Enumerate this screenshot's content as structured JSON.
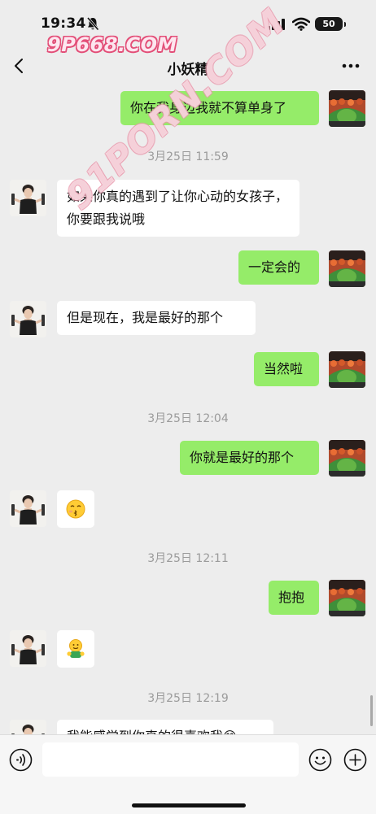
{
  "status_bar": {
    "time": "19:34",
    "battery": "50"
  },
  "watermarks": {
    "top": "9P668.COM",
    "diagonal": "91PORN.COM"
  },
  "nav": {
    "title": "小妖精"
  },
  "messages": [
    {
      "side": "right",
      "type": "text",
      "text": "你在我身边我就不算单身了"
    },
    {
      "type": "time",
      "text": "3月25日 11:59"
    },
    {
      "side": "left",
      "type": "text",
      "text": "如果你真的遇到了让你心动的女孩子，你要跟我说哦"
    },
    {
      "side": "right",
      "type": "text",
      "text": "一定会的"
    },
    {
      "side": "left",
      "type": "text",
      "text": "但是现在，我是最好的那个"
    },
    {
      "side": "right",
      "type": "text",
      "text": "当然啦"
    },
    {
      "type": "time",
      "text": "3月25日 12:04"
    },
    {
      "side": "right",
      "type": "text",
      "text": "你就是最好的那个"
    },
    {
      "side": "left",
      "type": "emoji",
      "icon": "kiss-emoji-icon"
    },
    {
      "type": "time",
      "text": "3月25日 12:11"
    },
    {
      "side": "right",
      "type": "text",
      "text": "抱抱"
    },
    {
      "side": "left",
      "type": "emoji",
      "icon": "hug-emoji-icon"
    },
    {
      "type": "time",
      "text": "3月25日 12:19"
    },
    {
      "side": "left",
      "type": "text",
      "text": "我能感觉到你真的很喜欢我😊"
    }
  ],
  "input": {
    "value": "",
    "placeholder": ""
  },
  "colors": {
    "background": "#ededed",
    "bubble_right": "#95ec69",
    "bubble_left": "#ffffff",
    "timestamp": "#9b9b9b"
  }
}
